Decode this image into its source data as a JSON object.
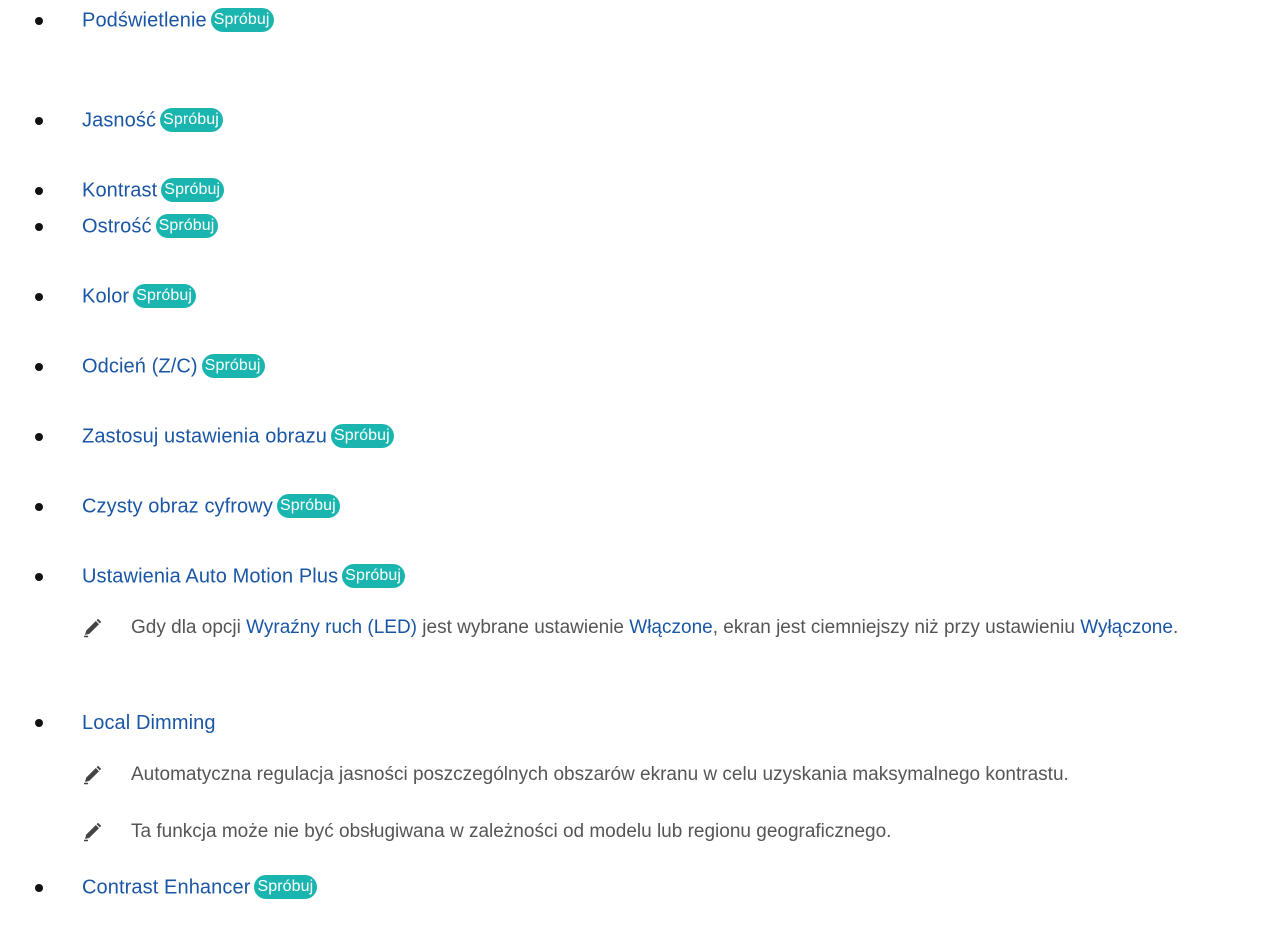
{
  "try_label": "Spróbuj",
  "items": [
    {
      "label": "Podświetlenie"
    },
    {
      "label": "Jasność"
    },
    {
      "label": "Kontrast"
    },
    {
      "label": "Ostrość"
    },
    {
      "label": "Kolor"
    },
    {
      "label": "Odcień (Z/C)"
    },
    {
      "label": "Zastosuj ustawienia obrazu"
    },
    {
      "label": "Czysty obraz cyfrowy"
    },
    {
      "label": "Ustawienia Auto Motion Plus"
    },
    {
      "label": "Local Dimming"
    },
    {
      "label": "Contrast Enhancer"
    }
  ],
  "notes": {
    "motion": {
      "part1": "Gdy dla opcji ",
      "link1": "Wyraźny ruch (LED)",
      "part2": " jest wybrane ustawienie ",
      "link2": "Włączone",
      "part3": ", ekran jest ciemniejszy niż przy ustawieniu ",
      "link3": "Wyłączone",
      "part4": "."
    },
    "dimming1": "Automatyczna regulacja jasności poszczególnych obszarów ekranu w celu uzyskania maksymalnego kontrastu.",
    "dimming2": "Ta funkcja może nie być obsługiwana w zależności od modelu lub regionu geograficznego."
  },
  "colors": {
    "link": "#1a56a6",
    "try_badge": "#1bb5b0",
    "note_text": "#555555"
  },
  "icons": {
    "note": "pencil-icon",
    "bullet": "bullet-icon"
  }
}
